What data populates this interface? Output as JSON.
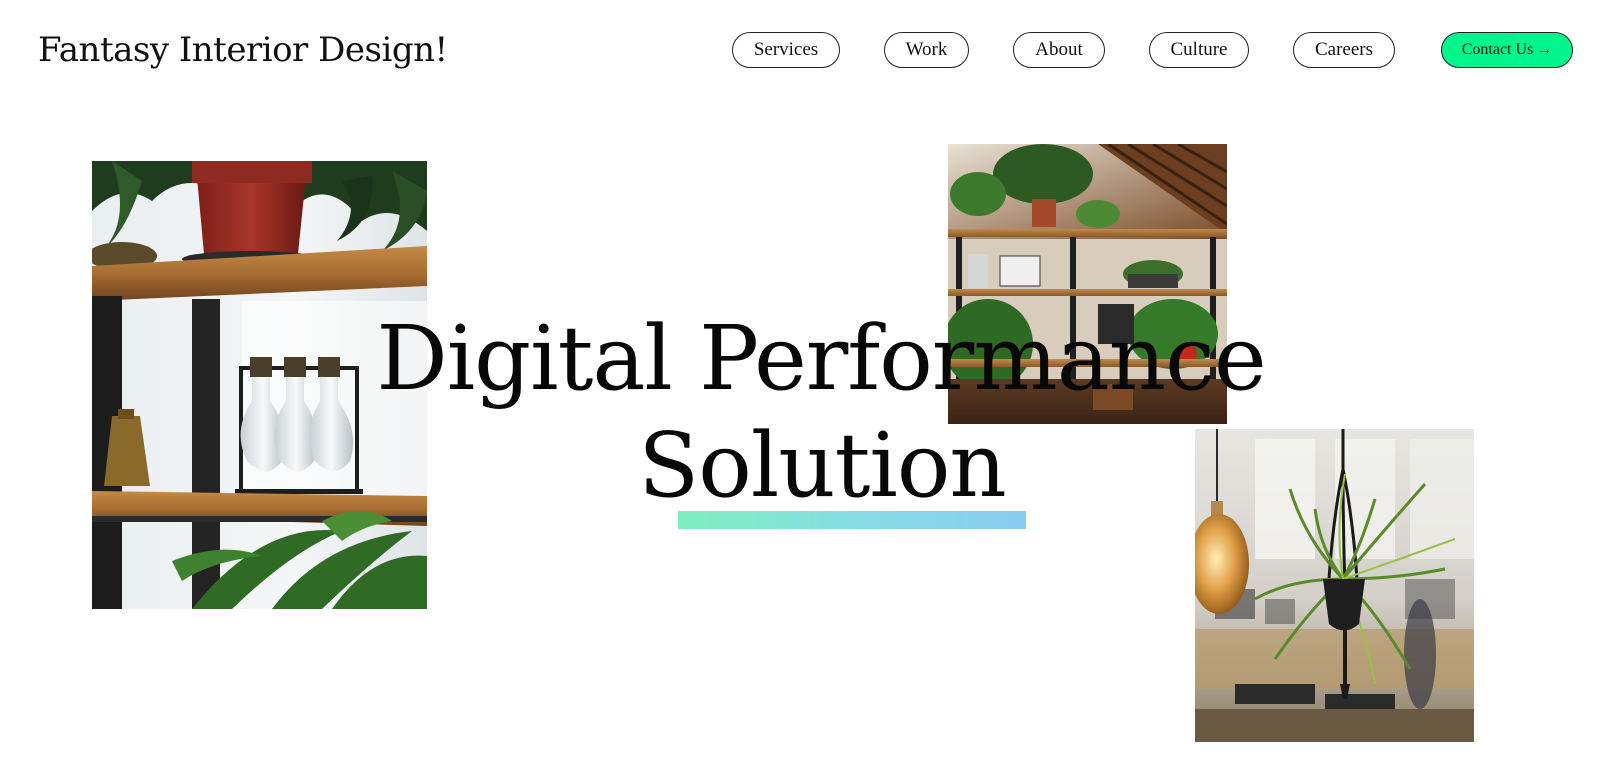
{
  "header": {
    "brand": "Fantasy Interior Design!",
    "nav": [
      {
        "label": "Services"
      },
      {
        "label": "Work"
      },
      {
        "label": "About"
      },
      {
        "label": "Culture"
      },
      {
        "label": "Careers"
      }
    ],
    "contact_label": "Contact Us",
    "contact_icon": "→"
  },
  "hero": {
    "line1": "Digital Performance",
    "line2": "Solution"
  },
  "colors": {
    "accent": "#00f58c",
    "underline_start": "#7ff0bf",
    "underline_end": "#88ccef"
  }
}
